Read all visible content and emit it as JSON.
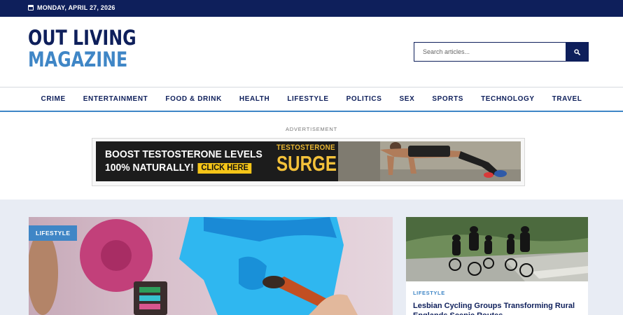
{
  "topbar": {
    "date": "MONDAY, APRIL 27, 2026"
  },
  "header": {
    "logo_line1": "OUT LIVING",
    "logo_line2": "MAGAZINE",
    "search_placeholder": "Search articles..."
  },
  "nav": {
    "items": [
      "CRIME",
      "ENTERTAINMENT",
      "FOOD & DRINK",
      "HEALTH",
      "LIFESTYLE",
      "POLITICS",
      "SEX",
      "SPORTS",
      "TECHNOLOGY",
      "TRAVEL"
    ]
  },
  "ad": {
    "label": "ADVERTISEMENT",
    "line1": "BOOST TESTOSTERONE LEVELS",
    "line2": "100% NATURALLY!",
    "cta": "CLICK HERE",
    "brand_top": "TESTOSTERONE",
    "brand_bottom": "SURGE"
  },
  "feature": {
    "category": "LIFESTYLE"
  },
  "card": {
    "category": "LIFESTYLE",
    "title": "Lesbian Cycling Groups Transforming Rural Englands Scenic Routes"
  },
  "colors": {
    "navy": "#0e1f5b",
    "accent_blue": "#3f86c6",
    "ad_yellow": "#f5c518",
    "main_bg": "#e8ecf4"
  },
  "icons": {
    "date": "calendar-icon",
    "search": "search-icon"
  }
}
